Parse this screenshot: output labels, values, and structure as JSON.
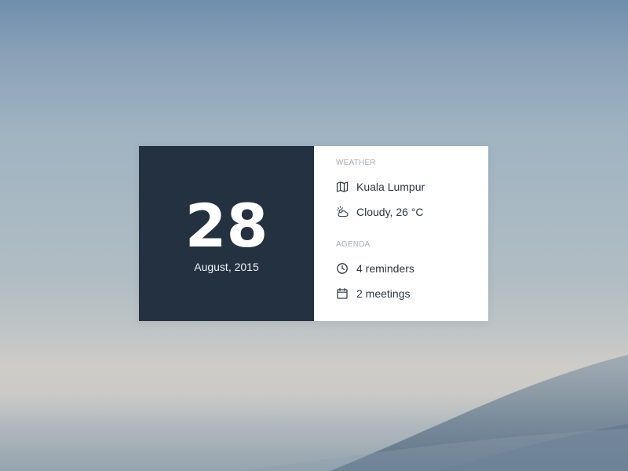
{
  "background": {
    "description_colors": {
      "sky_top": "#6f8ead",
      "horizon": "#cdcbc6",
      "hill": "#6f8496"
    }
  },
  "date_panel": {
    "day": "28",
    "month_year": "August, 2015",
    "background_color": "#243140"
  },
  "weather": {
    "section_title": "WEATHER",
    "location": {
      "icon": "map-icon",
      "label": "Kuala Lumpur"
    },
    "condition": {
      "icon": "partly-cloudy-icon",
      "label": "Cloudy, 26 °C"
    }
  },
  "agenda": {
    "section_title": "AGENDA",
    "reminders": {
      "icon": "clock-icon",
      "label": "4 reminders"
    },
    "meetings": {
      "icon": "calendar-icon",
      "label": "2 meetings"
    }
  }
}
